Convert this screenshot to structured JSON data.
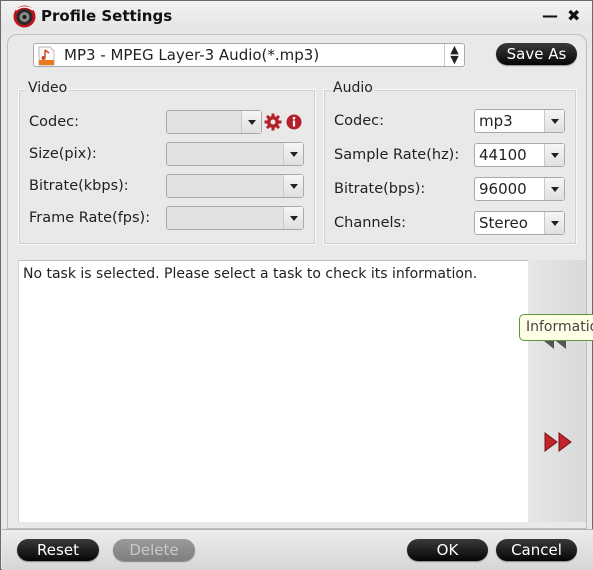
{
  "window": {
    "title": "Profile Settings",
    "minimize_label": "—",
    "close_label": "✖"
  },
  "profile": {
    "selected": "MP3 - MPEG Layer-3 Audio(*.mp3)",
    "icon": "mp3-file-icon",
    "spinner_label": "⬍"
  },
  "toolbar": {
    "save_as_label": "Save As"
  },
  "video": {
    "legend": "Video",
    "fields": [
      {
        "label": "Codec:",
        "value": ""
      },
      {
        "label": "Size(pix):",
        "value": ""
      },
      {
        "label": "Bitrate(kbps):",
        "value": ""
      },
      {
        "label": "Frame Rate(fps):",
        "value": ""
      }
    ],
    "settings_icon": "gear-icon",
    "info_icon": "info-icon"
  },
  "audio": {
    "legend": "Audio",
    "fields": [
      {
        "label": "Codec:",
        "value": "mp3"
      },
      {
        "label": "Sample Rate(hz):",
        "value": "44100"
      },
      {
        "label": "Bitrate(bps):",
        "value": "96000"
      },
      {
        "label": "Channels:",
        "value": "Stereo"
      }
    ]
  },
  "info": {
    "message": "No task is selected. Please select a task to check its information.",
    "tooltip": "Information"
  },
  "footer": {
    "reset_label": "Reset",
    "delete_label": "Delete",
    "ok_label": "OK",
    "cancel_label": "Cancel"
  },
  "colors": {
    "accent_red": "#b3202a",
    "button_dark": "#111111",
    "tooltip_bg": "#ffffe6"
  }
}
